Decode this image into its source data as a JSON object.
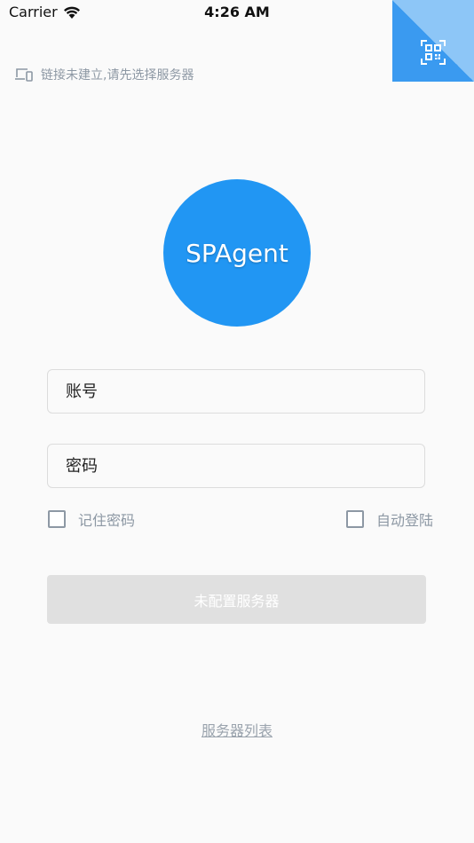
{
  "status_bar": {
    "carrier": "Carrier",
    "time": "4:26 AM"
  },
  "connection_notice": {
    "text": "链接未建立,请先选择服务器",
    "icon": "devices-icon"
  },
  "qr_button": {
    "icon": "qr-scan-icon"
  },
  "logo": {
    "text": "SPAgent"
  },
  "form": {
    "account_placeholder": "账号",
    "password_placeholder": "密码",
    "remember_password": "记住密码",
    "auto_login": "自动登陆",
    "submit_label": "未配置服务器"
  },
  "server_list_link": "服务器列表",
  "colors": {
    "accent": "#2196f3",
    "muted_text": "#8d98a4",
    "disabled_button": "#e0e0e0",
    "background": "#fafafa"
  }
}
